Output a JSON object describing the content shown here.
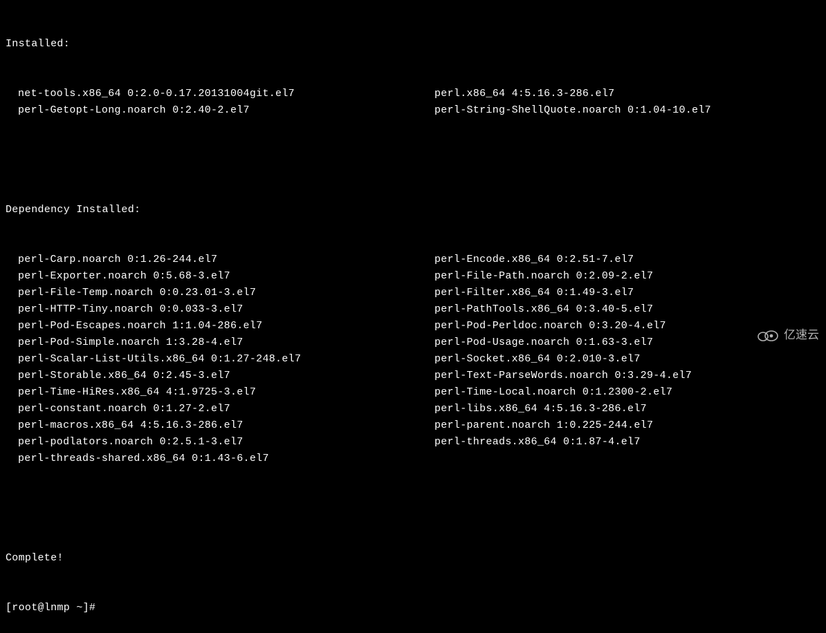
{
  "sections": {
    "installed": {
      "header": "Installed:",
      "rows": [
        {
          "left": "net-tools.x86_64 0:2.0-0.17.20131004git.el7",
          "right": "perl.x86_64 4:5.16.3-286.el7"
        },
        {
          "left": "perl-Getopt-Long.noarch 0:2.40-2.el7",
          "right": "perl-String-ShellQuote.noarch 0:1.04-10.el7"
        }
      ]
    },
    "dependency": {
      "header": "Dependency Installed:",
      "rows": [
        {
          "left": "perl-Carp.noarch 0:1.26-244.el7",
          "right": "perl-Encode.x86_64 0:2.51-7.el7"
        },
        {
          "left": "perl-Exporter.noarch 0:5.68-3.el7",
          "right": "perl-File-Path.noarch 0:2.09-2.el7"
        },
        {
          "left": "perl-File-Temp.noarch 0:0.23.01-3.el7",
          "right": "perl-Filter.x86_64 0:1.49-3.el7"
        },
        {
          "left": "perl-HTTP-Tiny.noarch 0:0.033-3.el7",
          "right": "perl-PathTools.x86_64 0:3.40-5.el7"
        },
        {
          "left": "perl-Pod-Escapes.noarch 1:1.04-286.el7",
          "right": "perl-Pod-Perldoc.noarch 0:3.20-4.el7"
        },
        {
          "left": "perl-Pod-Simple.noarch 1:3.28-4.el7",
          "right": "perl-Pod-Usage.noarch 0:1.63-3.el7"
        },
        {
          "left": "perl-Scalar-List-Utils.x86_64 0:1.27-248.el7",
          "right": "perl-Socket.x86_64 0:2.010-3.el7"
        },
        {
          "left": "perl-Storable.x86_64 0:2.45-3.el7",
          "right": "perl-Text-ParseWords.noarch 0:3.29-4.el7"
        },
        {
          "left": "perl-Time-HiRes.x86_64 4:1.9725-3.el7",
          "right": "perl-Time-Local.noarch 0:1.2300-2.el7"
        },
        {
          "left": "perl-constant.noarch 0:1.27-2.el7",
          "right": "perl-libs.x86_64 4:5.16.3-286.el7"
        },
        {
          "left": "perl-macros.x86_64 4:5.16.3-286.el7",
          "right": "perl-parent.noarch 1:0.225-244.el7"
        },
        {
          "left": "perl-podlators.noarch 0:2.5.1-3.el7",
          "right": "perl-threads.x86_64 0:1.87-4.el7"
        },
        {
          "left": "perl-threads-shared.x86_64 0:1.43-6.el7",
          "right": ""
        }
      ]
    }
  },
  "complete": "Complete!",
  "prompt": "[root@lnmp ~]# ",
  "watermark": {
    "text": "亿速云"
  }
}
